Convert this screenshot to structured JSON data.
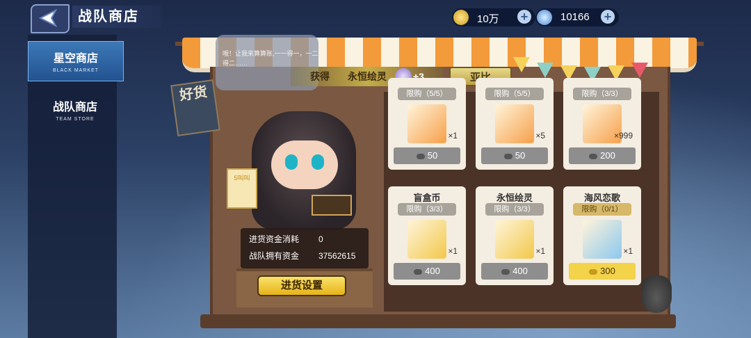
{
  "header": {
    "title": "战队商店",
    "gold": {
      "icon": "gold-coins-icon",
      "value": "10万"
    },
    "gems": {
      "icon": "crystal-medal-icon",
      "value": "10166"
    }
  },
  "sidebar": {
    "items": [
      {
        "label": "星空商店",
        "sub": "BLACK MARKET",
        "active": true
      },
      {
        "label": "战队商店",
        "sub": "TEAM STORE",
        "active": false
      }
    ]
  },
  "merchant": {
    "speech": "哦！让我来算算账,一一得一，一二得二……",
    "sign": "好货",
    "wanted_text": "5叫叫"
  },
  "gain_banner": {
    "label": "获得",
    "item": "永恒绘灵",
    "amount": "+3"
  },
  "npc_name": "亚比",
  "funds": {
    "spent_label": "进货资金消耗",
    "spent_value": "0",
    "owned_label": "战队拥有资金",
    "owned_value": "37562615"
  },
  "restock_button": "进货设置",
  "cards": [
    {
      "name": "",
      "limit": "限购（5/5）",
      "qty": "×1",
      "price": "50",
      "art": "blue-crystal-shard",
      "color": "#f6a04a",
      "highlight": false
    },
    {
      "name": "",
      "limit": "限购（5/5）",
      "qty": "×5",
      "price": "50",
      "art": "blue-gem-stone",
      "color": "#f6a04a",
      "highlight": false
    },
    {
      "name": "",
      "limit": "限购（3/3）",
      "qty": "×999",
      "price": "200",
      "art": "red-gold-crystal",
      "color": "#f6a04a",
      "highlight": false
    },
    {
      "name": "盲盒币",
      "limit": "限购（3/3）",
      "qty": "×1",
      "price": "400",
      "art": "blind-box-coin",
      "color": "#f2c84a",
      "highlight": false
    },
    {
      "name": "永恒绘灵",
      "limit": "限购（3/3）",
      "qty": "×1",
      "price": "400",
      "art": "eternal-spirit-orb",
      "color": "#f2c84a",
      "highlight": false
    },
    {
      "name": "海风恋歌",
      "limit": "限购（0/1）",
      "qty": "×1",
      "price": "300",
      "art": "sea-breeze-cake",
      "color": "#8cc8ef",
      "highlight": true
    }
  ]
}
